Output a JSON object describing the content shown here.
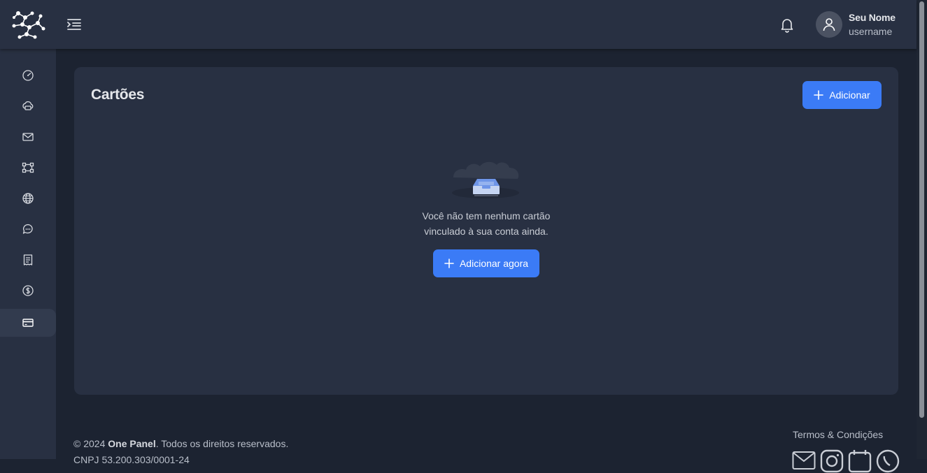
{
  "header": {
    "user_name": "Seu Nome",
    "user_handle": "username"
  },
  "sidebar": {
    "items": [
      {
        "icon": "dashboard-icon"
      },
      {
        "icon": "cloud-server-icon"
      },
      {
        "icon": "mail-icon"
      },
      {
        "icon": "vector-square-icon"
      },
      {
        "icon": "globe-icon"
      },
      {
        "icon": "chat-icon"
      },
      {
        "icon": "invoice-icon"
      },
      {
        "icon": "dollar-icon"
      },
      {
        "icon": "credit-card-icon",
        "active": true
      }
    ]
  },
  "main": {
    "title": "Cartões",
    "add_label": "Adicionar",
    "empty_line1": "Você não tem nenhum cartão",
    "empty_line2": "vinculado à sua conta ainda.",
    "add_now_label": "Adicionar agora"
  },
  "footer": {
    "copyright_prefix": "© 2024 ",
    "brand": "One Panel",
    "copyright_suffix": ". Todos os direitos reservados.",
    "cnpj": "CNPJ 53.200.303/0001-24",
    "terms": "Termos & Condições",
    "social": [
      "mail-icon",
      "instagram-icon",
      "calendar-icon",
      "whatsapp-icon"
    ]
  },
  "colors": {
    "accent": "#3b7bf6",
    "background": "#1c2331",
    "surface": "#283042"
  }
}
